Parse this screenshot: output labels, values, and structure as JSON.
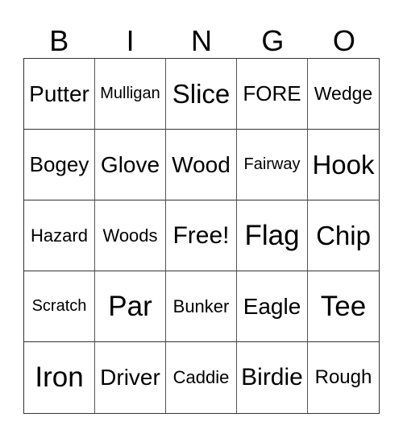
{
  "header": [
    "B",
    "I",
    "N",
    "G",
    "O"
  ],
  "cells": [
    [
      "Putter",
      "Mulligan",
      "Slice",
      "FORE",
      "Wedge"
    ],
    [
      "Bogey",
      "Glove",
      "Wood",
      "Fairway",
      "Hook"
    ],
    [
      "Hazard",
      "Woods",
      "Free!",
      "Flag",
      "Chip"
    ],
    [
      "Scratch",
      "Par",
      "Bunker",
      "Eagle",
      "Tee"
    ],
    [
      "Iron",
      "Driver",
      "Caddie",
      "Birdie",
      "Rough"
    ]
  ]
}
